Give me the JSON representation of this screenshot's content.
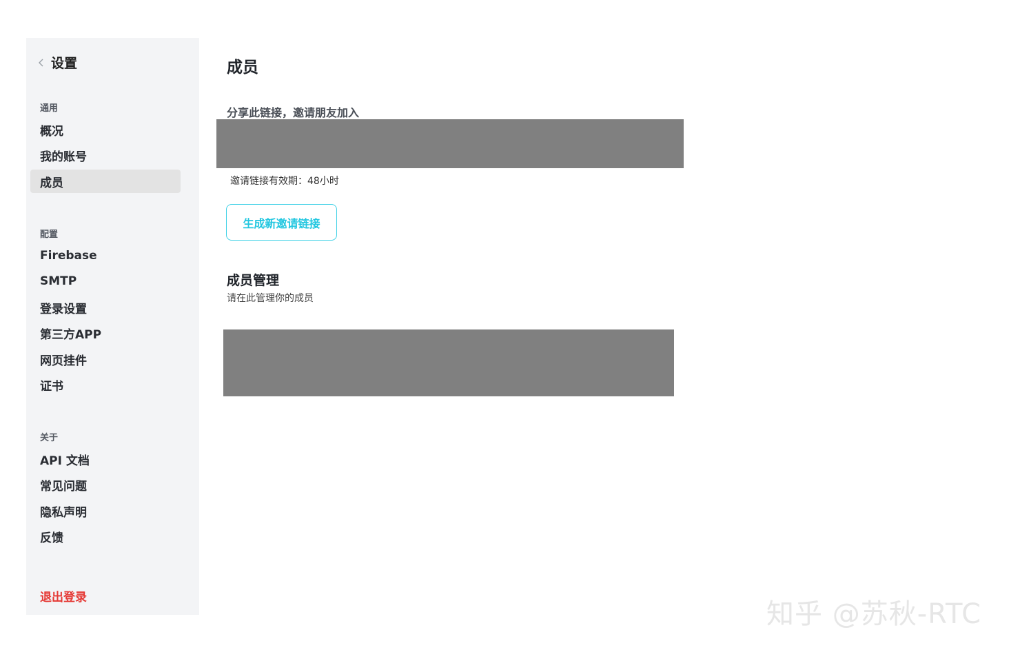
{
  "sidebar": {
    "back_icon": "chevron-left-icon",
    "title": "设置",
    "groups": [
      {
        "label": "通用",
        "items": [
          "概况",
          "我的账号",
          "成员"
        ]
      },
      {
        "label": "配置",
        "items": [
          "Firebase",
          "SMTP",
          "登录设置",
          "第三方APP",
          "网页挂件",
          "证书"
        ]
      },
      {
        "label": "关于",
        "items": [
          "API 文档",
          "常见问题",
          "隐私声明",
          "反馈"
        ]
      }
    ],
    "active_item": "成员",
    "logout_label": "退出登录"
  },
  "main": {
    "title": "成员",
    "share_label": "分享此链接，邀请朋友加入",
    "expiry_text": "邀请链接有效期：48小时",
    "generate_button": "生成新邀请链接",
    "section_title": "成员管理",
    "section_subtitle": "请在此管理你的成员"
  },
  "watermark": "知乎 @苏秋-RTC",
  "colors": {
    "sidebar_bg": "#f3f4f6",
    "active_bg": "#e3e3e3",
    "accent": "#22c7e0",
    "danger": "#e53935",
    "redacted": "#808080"
  }
}
